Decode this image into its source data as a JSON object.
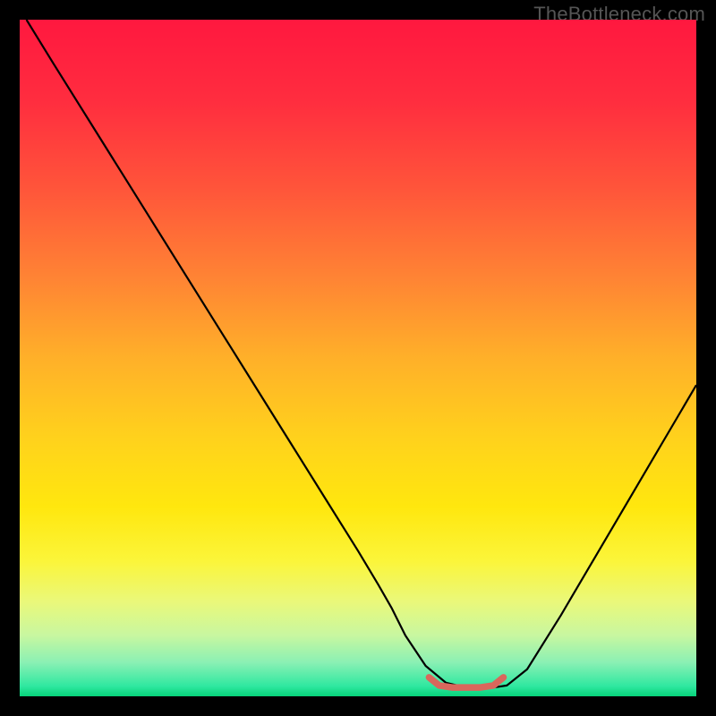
{
  "watermark": "TheBottleneck.com",
  "chart_data": {
    "type": "line",
    "title": "",
    "xlabel": "",
    "ylabel": "",
    "xlim": [
      0,
      100
    ],
    "ylim": [
      0,
      100
    ],
    "background_gradient_stops": [
      {
        "offset": 0.0,
        "color": "#ff183f"
      },
      {
        "offset": 0.12,
        "color": "#ff2d3f"
      },
      {
        "offset": 0.25,
        "color": "#ff553a"
      },
      {
        "offset": 0.38,
        "color": "#ff8334"
      },
      {
        "offset": 0.5,
        "color": "#ffb029"
      },
      {
        "offset": 0.62,
        "color": "#ffd21c"
      },
      {
        "offset": 0.72,
        "color": "#ffe70e"
      },
      {
        "offset": 0.8,
        "color": "#fbf53a"
      },
      {
        "offset": 0.86,
        "color": "#eaf87a"
      },
      {
        "offset": 0.91,
        "color": "#c8f7a0"
      },
      {
        "offset": 0.95,
        "color": "#8af0b4"
      },
      {
        "offset": 0.985,
        "color": "#2fe8a0"
      },
      {
        "offset": 1.0,
        "color": "#06d37a"
      }
    ],
    "series": [
      {
        "name": "bottleneck-curve",
        "stroke": "#000000",
        "stroke_width": 2.2,
        "x": [
          1,
          5,
          10,
          15,
          20,
          25,
          30,
          35,
          40,
          45,
          50,
          53,
          55,
          57,
          60,
          63,
          66,
          68,
          70,
          72,
          75,
          80,
          85,
          90,
          95,
          100
        ],
        "y": [
          100,
          93.5,
          85.5,
          77.5,
          69.5,
          61.5,
          53.5,
          45.5,
          37.5,
          29.5,
          21.5,
          16.5,
          13,
          9,
          4.5,
          2.0,
          1.3,
          1.3,
          1.3,
          1.6,
          4.0,
          12,
          20.5,
          29,
          37.5,
          46
        ]
      },
      {
        "name": "optimal-range",
        "stroke": "#d9675c",
        "stroke_width": 7.5,
        "linecap": "round",
        "x": [
          60.5,
          62,
          64,
          66,
          68,
          70,
          71.5
        ],
        "y": [
          2.8,
          1.6,
          1.3,
          1.3,
          1.3,
          1.6,
          2.8
        ]
      }
    ]
  }
}
